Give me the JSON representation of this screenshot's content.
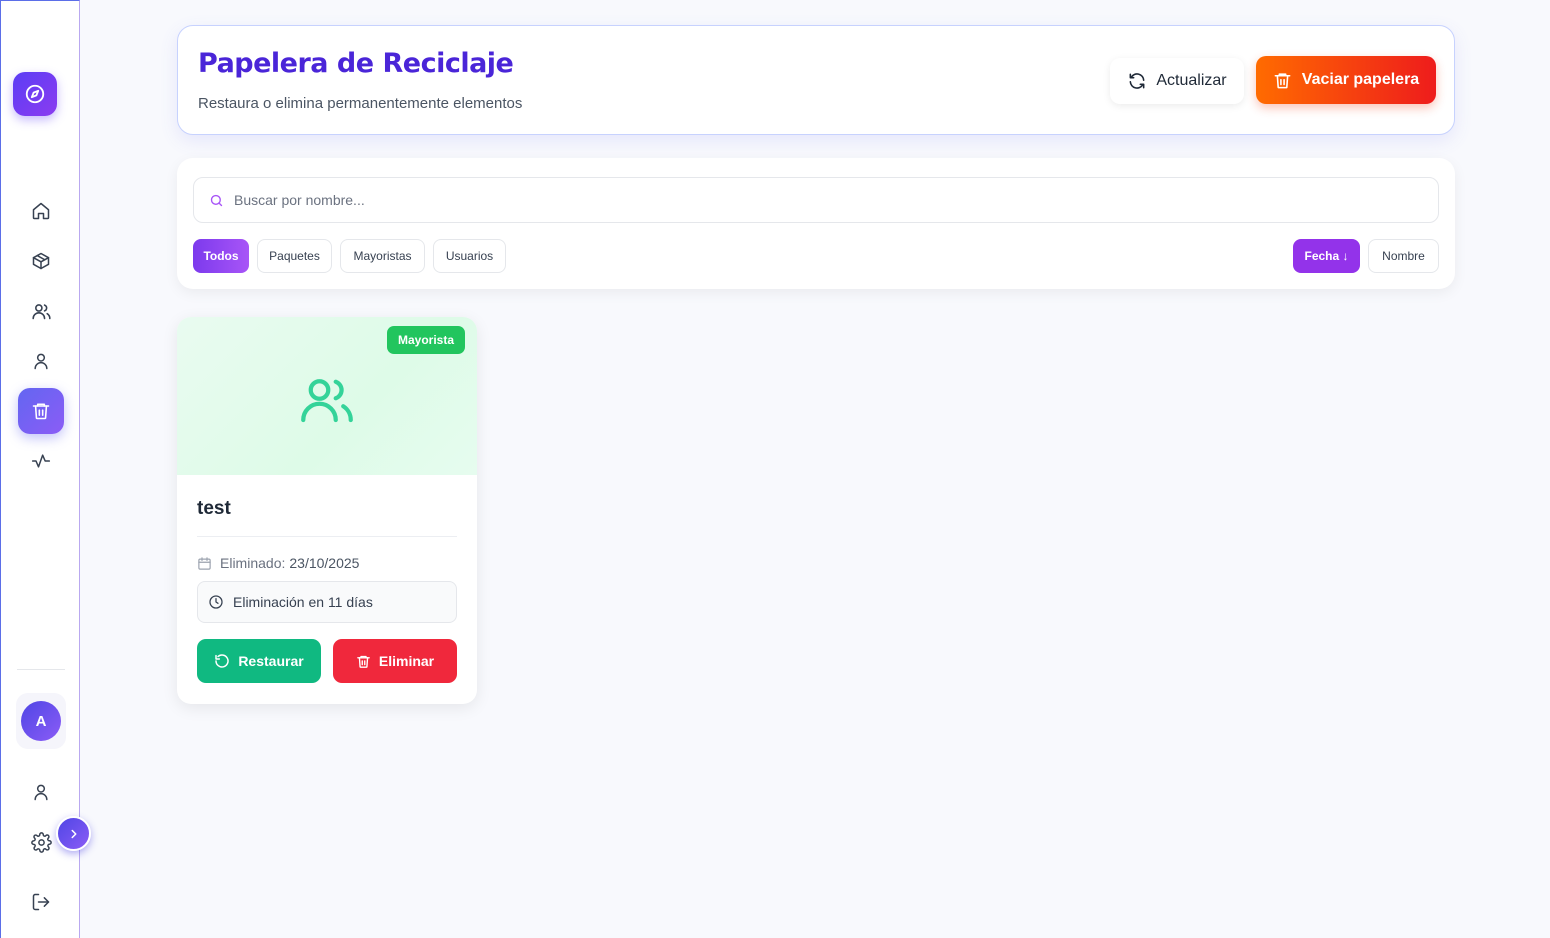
{
  "sidebar": {
    "logo_icon": "compass-icon",
    "nav": [
      {
        "name": "home",
        "icon": "home-icon"
      },
      {
        "name": "packages",
        "icon": "box-icon"
      },
      {
        "name": "wholesalers",
        "icon": "users-icon"
      },
      {
        "name": "users",
        "icon": "user-icon"
      },
      {
        "name": "trash",
        "icon": "trash-icon",
        "active": true
      },
      {
        "name": "activity",
        "icon": "activity-icon"
      }
    ],
    "avatar_initial": "A",
    "bottom": [
      {
        "name": "profile",
        "icon": "user-icon"
      },
      {
        "name": "settings",
        "icon": "gear-icon"
      },
      {
        "name": "logout",
        "icon": "logout-icon"
      }
    ],
    "expand_icon": "chevron-right-icon"
  },
  "header": {
    "title": "Papelera de Reciclaje",
    "subtitle": "Restaura o elimina permanentemente elementos",
    "refresh_label": "Actualizar",
    "empty_label": "Vaciar papelera"
  },
  "filters": {
    "search_placeholder": "Buscar por nombre...",
    "search_value": "",
    "types": [
      {
        "label": "Todos",
        "active": true
      },
      {
        "label": "Paquetes",
        "active": false
      },
      {
        "label": "Mayoristas",
        "active": false
      },
      {
        "label": "Usuarios",
        "active": false
      }
    ],
    "sort": [
      {
        "label": "Fecha ↓",
        "active": true
      },
      {
        "label": "Nombre",
        "active": false
      }
    ]
  },
  "items": [
    {
      "type_badge": "Mayorista",
      "name": "test",
      "deleted_label": "Eliminado:",
      "deleted_date": "23/10/2025",
      "expiry_text": "Eliminación en 11 días",
      "restore_label": "Restaurar",
      "delete_label": "Eliminar"
    }
  ],
  "colors": {
    "title": "#4a25d8",
    "accent": "#6366f1",
    "restore": "#10b981",
    "delete": "#f0283c",
    "badge": "#22c55e"
  }
}
